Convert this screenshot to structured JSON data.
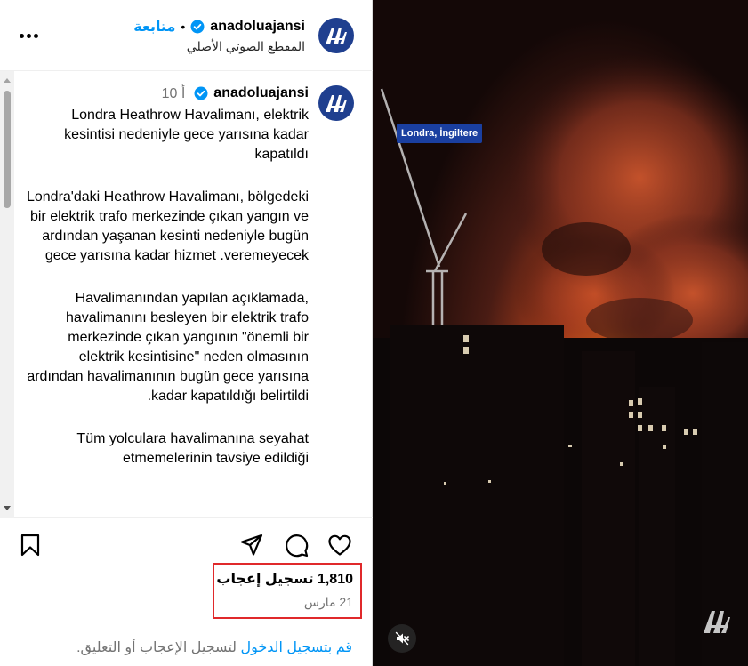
{
  "header": {
    "username": "anadoluajansi",
    "follow_label": "متابعة",
    "separator": "•",
    "audio_subtitle": "المقطع الصوتي الأصلي"
  },
  "post": {
    "username": "anadoluajansi",
    "time_ago": "10 أ",
    "caption_paragraphs": [
      "Londra Heathrow Havalimanı, elektrik kesintisi nedeniyle gece yarısına kadar kapatıldı",
      "Londra'daki Heathrow Havalimanı, bölgedeki bir elektrik trafo merkezinde çıkan yangın ve ardından yaşanan kesinti nedeniyle bugün gece yarısına kadar hizmet .veremeyecek",
      "Havalimanından yapılan açıklamada, havalimanını besleyen bir elektrik trafo merkezinde çıkan yangının \"önemli bir elektrik kesintisine\" neden olmasının ardından havalimanının bugün gece yarısına .kadar kapatıldığı belirtildi",
      "Tüm yolculara havalimanına seyahat etmemelerinin tavsiye edildiği"
    ]
  },
  "stats": {
    "likes": "1,810 تسجيل إعجاب",
    "date": "21 مارس"
  },
  "login_prompt": {
    "link": "قم بتسجيل الدخول",
    "rest": " لتسجيل الإعجاب أو التعليق."
  },
  "media": {
    "location_tag": "Londra, İngiltere"
  },
  "colors": {
    "accent": "#0095f6",
    "highlight_border": "#e0292b",
    "brand_avatar": "#1f3f8f"
  },
  "icons": [
    "more-icon",
    "verified-icon",
    "bookmark-icon",
    "share-icon",
    "comment-icon",
    "heart-icon",
    "mute-icon",
    "aa-logo-icon"
  ]
}
